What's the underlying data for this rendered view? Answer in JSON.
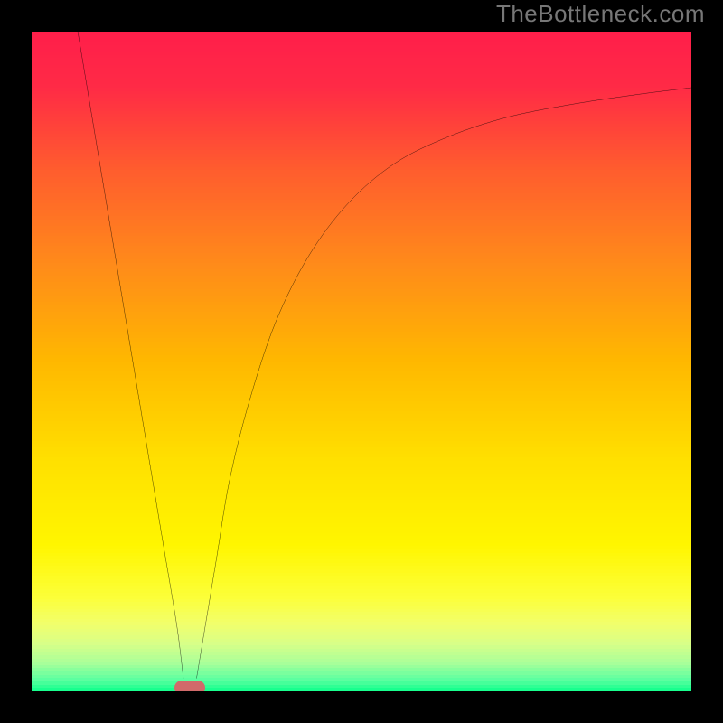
{
  "watermark": "TheBottleneck.com",
  "colors": {
    "black": "#000000",
    "marker": "#d16a6a",
    "curve": "#000000"
  },
  "chart_data": {
    "type": "line",
    "title": "",
    "xlabel": "",
    "ylabel": "",
    "xlim": [
      0,
      100
    ],
    "ylim": [
      0,
      100
    ],
    "grid": false,
    "legend": false,
    "gradient_stops": [
      {
        "t": 0.0,
        "color": "#ff1f4a"
      },
      {
        "t": 0.08,
        "color": "#ff2a46"
      },
      {
        "t": 0.2,
        "color": "#ff5a2f"
      },
      {
        "t": 0.35,
        "color": "#ff8a1a"
      },
      {
        "t": 0.5,
        "color": "#ffb800"
      },
      {
        "t": 0.65,
        "color": "#ffe000"
      },
      {
        "t": 0.78,
        "color": "#fff600"
      },
      {
        "t": 0.86,
        "color": "#fcff3a"
      },
      {
        "t": 0.9,
        "color": "#f1ff6c"
      },
      {
        "t": 0.93,
        "color": "#d8ff88"
      },
      {
        "t": 0.96,
        "color": "#a7ff9a"
      },
      {
        "t": 0.985,
        "color": "#5cffa0"
      },
      {
        "t": 1.0,
        "color": "#18ff8e"
      }
    ],
    "series": [
      {
        "name": "left-branch",
        "x": [
          7,
          8,
          10,
          12,
          14,
          16,
          18,
          20,
          22,
          23
        ],
        "y": [
          100,
          94,
          82,
          70,
          58,
          46,
          34,
          22,
          10,
          2
        ]
      },
      {
        "name": "right-branch",
        "x": [
          25,
          26,
          28,
          30,
          33,
          37,
          42,
          48,
          55,
          63,
          72,
          82,
          92,
          100
        ],
        "y": [
          2,
          8,
          20,
          32,
          44,
          56,
          66,
          74,
          80,
          84,
          87,
          89,
          90.5,
          91.5
        ]
      }
    ],
    "marker": {
      "x": 24,
      "y": 0.5
    },
    "annotations": []
  }
}
